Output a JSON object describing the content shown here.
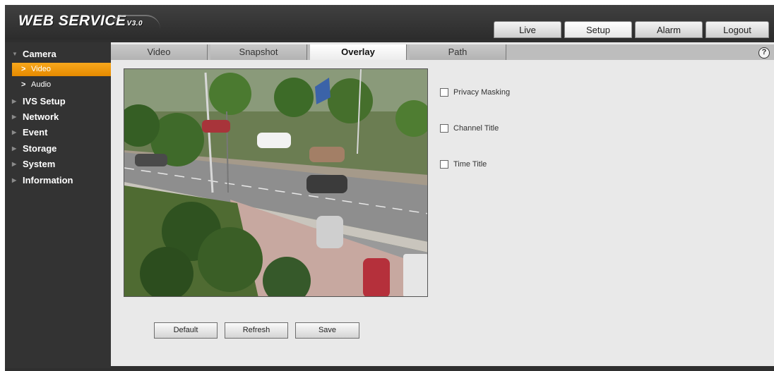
{
  "header": {
    "logo_text": "WEB SERVICE",
    "logo_version": "V3.0",
    "tabs": [
      {
        "label": "Live"
      },
      {
        "label": "Setup"
      },
      {
        "label": "Alarm"
      },
      {
        "label": "Logout"
      }
    ]
  },
  "sidebar": {
    "items": [
      {
        "label": "Camera",
        "expanded": true
      },
      {
        "label": "IVS Setup"
      },
      {
        "label": "Network"
      },
      {
        "label": "Event"
      },
      {
        "label": "Storage"
      },
      {
        "label": "System"
      },
      {
        "label": "Information"
      }
    ],
    "camera_children": [
      {
        "label": "Video",
        "active": true
      },
      {
        "label": "Audio"
      }
    ]
  },
  "content": {
    "tabs": [
      {
        "label": "Video"
      },
      {
        "label": "Snapshot"
      },
      {
        "label": "Overlay",
        "active": true
      },
      {
        "label": "Path"
      }
    ],
    "help_icon": "?",
    "options": [
      {
        "label": "Privacy Masking",
        "checked": false
      },
      {
        "label": "Channel Title",
        "checked": false
      },
      {
        "label": "Time Title",
        "checked": false
      }
    ],
    "buttons": {
      "default": "Default",
      "refresh": "Refresh",
      "save": "Save"
    }
  },
  "colors": {
    "accent": "#f39a0e",
    "sidebar_bg": "#333333",
    "content_bg": "#e9e9e9"
  }
}
